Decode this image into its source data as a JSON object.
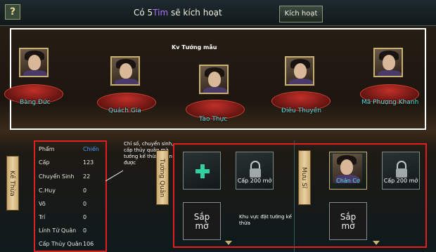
{
  "header": {
    "activation_prefix": "Có 5",
    "activation_highlight": "Tim",
    "activation_suffix": " sẽ kích hoạt",
    "activate_button": "Kích hoạt",
    "help_label": "?"
  },
  "template_area": {
    "label": "Kv Tướng mẫu",
    "generals": [
      {
        "name": "Bàng Đức"
      },
      {
        "name": "Quách Gia"
      },
      {
        "name": "Tào Thực"
      },
      {
        "name": "Điêu Thuyền"
      },
      {
        "name": "Mã Phượng Khanh"
      }
    ]
  },
  "inherit": {
    "tab_label": "Kế Thừa",
    "stats": [
      {
        "label": "Phẩm",
        "value": "Chiến",
        "highlight": true
      },
      {
        "label": "Cấp",
        "value": "123"
      },
      {
        "label": "Chuyển Sinh",
        "value": "22"
      },
      {
        "label": "C.Huy",
        "value": "0"
      },
      {
        "label": "Võ",
        "value": "0"
      },
      {
        "label": "Trí",
        "value": "0"
      },
      {
        "label": "Lính Tử Quân",
        "value": "0"
      },
      {
        "label": "Cấp Thủy Quân",
        "value": "106"
      }
    ],
    "note": "Chỉ số, chuyển sinh, cấp thủy quân mà tướng kế thừa nhận được"
  },
  "slots": {
    "left_tab": "Tướng Quân",
    "right_tab": "Mưu Sĩ",
    "lock_label": "Cấp 200 mở",
    "big_label_1": "Sắp",
    "big_label_2": "mở",
    "chan_co": "Chân Cơ",
    "note": "Khu vực đặt tướng kế thừa"
  },
  "colors": {
    "accent_red": "#e02020",
    "cyan_name": "#50e0e0",
    "highlight_purple": "#b070ff"
  }
}
